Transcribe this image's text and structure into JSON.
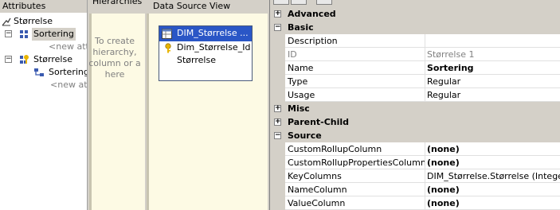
{
  "attributes_pane": {
    "header": "Attributes",
    "root": "Størrelse",
    "children": [
      {
        "label": "Sortering",
        "selected": true
      },
      {
        "label": "<new attr",
        "placeholder": true
      }
    ],
    "dimension": {
      "label": "Størrelse",
      "children": [
        {
          "label": "Sortering"
        },
        {
          "label": "<new attri",
          "placeholder": true
        }
      ]
    }
  },
  "hierarchies_pane": {
    "header": "Hierarchies",
    "hint_lines": [
      "To create",
      "hierarchy,",
      "column or a",
      "here"
    ]
  },
  "dsv_pane": {
    "header": "Data Source View",
    "table": {
      "title": "DIM_Størrelse ...",
      "columns": [
        {
          "name": "Dim_Størrelse_Id",
          "key": true,
          "icon": "key-icon"
        },
        {
          "name": "Størrelse",
          "key": false
        }
      ]
    }
  },
  "properties": {
    "categories": [
      {
        "name": "Advanced",
        "expanded": false,
        "props": []
      },
      {
        "name": "Basic",
        "expanded": true,
        "props": [
          {
            "name": "Description",
            "value": "",
            "bold": false,
            "readonly": false
          },
          {
            "name": "ID",
            "value": "Størrelse 1",
            "bold": false,
            "readonly": true
          },
          {
            "name": "Name",
            "value": "Sortering",
            "bold": true,
            "readonly": false
          },
          {
            "name": "Type",
            "value": "Regular",
            "bold": false,
            "readonly": false
          },
          {
            "name": "Usage",
            "value": "Regular",
            "bold": false,
            "readonly": false
          }
        ]
      },
      {
        "name": "Misc",
        "expanded": false,
        "props": []
      },
      {
        "name": "Parent-Child",
        "expanded": false,
        "props": []
      },
      {
        "name": "Source",
        "expanded": true,
        "props": [
          {
            "name": "CustomRollupColumn",
            "value": "(none)",
            "bold": true,
            "readonly": false
          },
          {
            "name": "CustomRollupPropertiesColumn",
            "value": "(none)",
            "bold": true,
            "readonly": false
          },
          {
            "name": "KeyColumns",
            "value": "DIM_Størrelse.Størrelse (Integer)",
            "bold": false,
            "readonly": false
          },
          {
            "name": "NameColumn",
            "value": "(none)",
            "bold": true,
            "readonly": false
          },
          {
            "name": "ValueColumn",
            "value": "(none)",
            "bold": true,
            "readonly": false
          }
        ]
      }
    ]
  },
  "colors": {
    "selection": "#2a56c6",
    "canvas": "#fdfae4",
    "chrome": "#d4d0c8"
  }
}
